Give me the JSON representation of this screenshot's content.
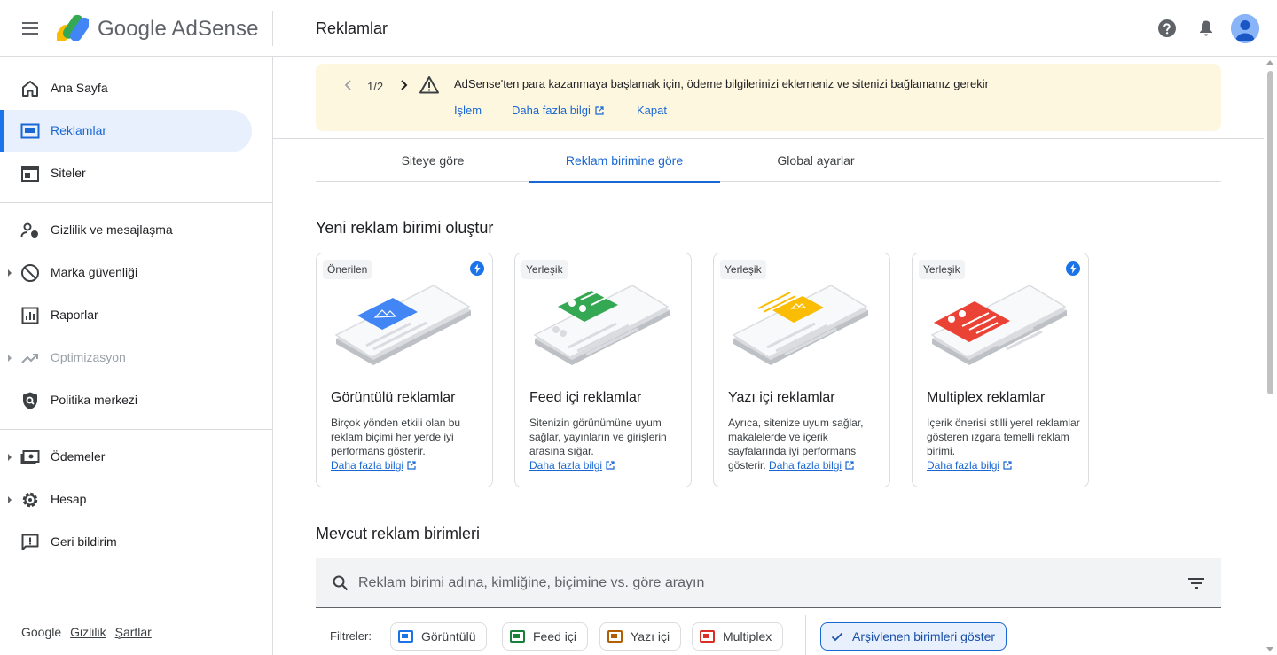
{
  "app": {
    "logo_text": "Google AdSense",
    "page_title": "Reklamlar",
    "icons": [
      "menu-icon",
      "adsense-logo",
      "help-icon",
      "notifications-icon",
      "account-avatar"
    ]
  },
  "sidebar": {
    "items": [
      {
        "label": "Ana Sayfa",
        "icon": "home-icon",
        "active": false
      },
      {
        "label": "Reklamlar",
        "icon": "ads-icon",
        "active": true
      },
      {
        "label": "Siteler",
        "icon": "sites-icon",
        "active": false
      },
      {
        "label": "Gizlilik ve mesajlaşma",
        "icon": "privacy-icon",
        "active": false
      },
      {
        "label": "Marka güvenliği",
        "icon": "block-icon",
        "active": false,
        "expandable": true
      },
      {
        "label": "Raporlar",
        "icon": "reports-icon",
        "active": false
      },
      {
        "label": "Optimizasyon",
        "icon": "trending-icon",
        "active": false,
        "expandable": true,
        "disabled": true
      },
      {
        "label": "Politika merkezi",
        "icon": "policy-icon",
        "active": false
      },
      {
        "label": "Ödemeler",
        "icon": "payments-icon",
        "active": false,
        "expandable": true
      },
      {
        "label": "Hesap",
        "icon": "settings-icon",
        "active": false,
        "expandable": true
      },
      {
        "label": "Geri bildirim",
        "icon": "feedback-icon",
        "active": false
      }
    ],
    "footer": {
      "brand": "Google",
      "privacy": "Gizlilik",
      "terms": "Şartlar"
    }
  },
  "banner": {
    "counter": "1/2",
    "message": "AdSense'ten para kazanmaya başlamak için, ödeme bilgilerinizi eklemeniz ve sitenizi bağlamanız gerekir",
    "action": "İşlem",
    "learn_more": "Daha fazla bilgi",
    "dismiss": "Kapat"
  },
  "tabs": [
    {
      "label": "Siteye göre",
      "active": false
    },
    {
      "label": "Reklam birimine göre",
      "active": true
    },
    {
      "label": "Global ayarlar",
      "active": false
    }
  ],
  "create_section": {
    "title": "Yeni reklam birimi oluştur",
    "cards": [
      {
        "chip": "Önerilen",
        "bolt": true,
        "title": "Görüntülü reklamlar",
        "desc": "Birçok yönden etkili olan bu reklam biçimi her yerde iyi performans gösterir.",
        "link": "Daha fazla bilgi",
        "color": "#4285f4"
      },
      {
        "chip": "Yerleşik",
        "bolt": false,
        "title": "Feed içi reklamlar",
        "desc": "Sitenizin görünümüne uyum sağlar, yayınların ve girişlerin arasına sığar.",
        "link": "Daha fazla bilgi",
        "color": "#34a853"
      },
      {
        "chip": "Yerleşik",
        "bolt": false,
        "title": "Yazı içi reklamlar",
        "desc": "Ayrıca, sitenize uyum sağlar, makalelerde ve içerik sayfalarında iyi performans gösterir.",
        "link": "Daha fazla bilgi",
        "color": "#fbbc04"
      },
      {
        "chip": "Yerleşik",
        "bolt": true,
        "title": "Multiplex reklamlar",
        "desc": "İçerik önerisi stilli yerel reklamlar gösteren ızgara temelli reklam birimi.",
        "link": "Daha fazla bilgi",
        "color": "#ea4335"
      }
    ]
  },
  "existing_section": {
    "title": "Mevcut reklam birimleri",
    "search_placeholder": "Reklam birimi adına, kimliğine, biçimine vs. göre arayın",
    "filters_label": "Filtreler:",
    "filters": [
      {
        "label": "Görüntülü",
        "color": "#1a73e8"
      },
      {
        "label": "Feed içi",
        "color": "#188038"
      },
      {
        "label": "Yazı içi",
        "color": "#b06000"
      },
      {
        "label": "Multiplex",
        "color": "#d93025"
      }
    ],
    "archived_toggle": "Arşivlenen birimleri göster"
  }
}
